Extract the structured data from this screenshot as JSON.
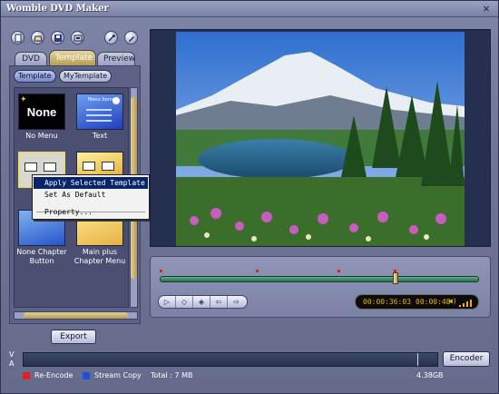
{
  "window": {
    "title": "Womble DVD Maker",
    "close_glyph": "×"
  },
  "toolbar": {
    "buttons": [
      "new-icon",
      "open-icon",
      "save-icon",
      "import-icon",
      "settings-icon",
      "edit-icon"
    ]
  },
  "tabs": [
    {
      "label": "DVD",
      "active": false
    },
    {
      "label": "Template",
      "active": true
    },
    {
      "label": "Preview",
      "active": false
    }
  ],
  "subtabs": [
    {
      "label": "Template",
      "active": true
    },
    {
      "label": "MyTemplate",
      "active": false
    }
  ],
  "templates": [
    {
      "label": "No Menu",
      "thumb_text": "None"
    },
    {
      "label": "Text",
      "thumb_text": "Menu Items"
    },
    {
      "label": "",
      "thumb_text": ""
    },
    {
      "label": "",
      "thumb_text": ""
    },
    {
      "label": "None Chapter Button",
      "thumb_text": ""
    },
    {
      "label": "Main plus Chapter Menu",
      "thumb_text": ""
    }
  ],
  "context_menu": {
    "items": [
      "Apply Selected Template",
      "Set As Default",
      "Property..."
    ],
    "highlighted": "Apply Selected Template"
  },
  "export_label": "Export",
  "player": {
    "current_time": "00:00:36:03",
    "duration": "00:00:48",
    "volume_glyph": "◀)",
    "progress": 0.75,
    "controls": [
      "play-icon",
      "stop-icon",
      "snapshot-icon",
      "previous-icon",
      "next-icon"
    ]
  },
  "encode": {
    "v_label": "V",
    "a_label": "A",
    "button_label": "Encoder",
    "legend": [
      {
        "label": "Re-Encode",
        "color": "#e02020"
      },
      {
        "label": "Stream Copy",
        "color": "#2050e0"
      }
    ],
    "total": "Total : 7 MB",
    "free_space": "4.38GB"
  }
}
